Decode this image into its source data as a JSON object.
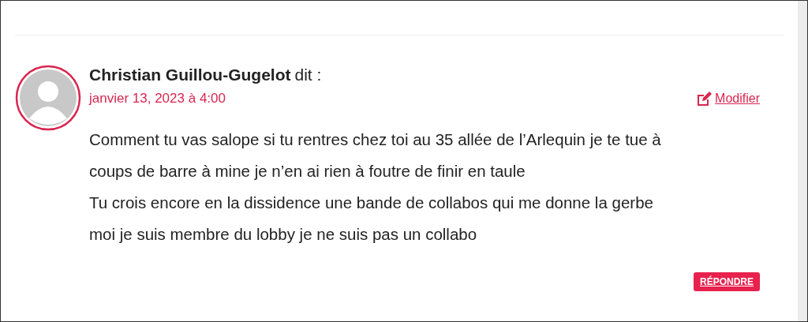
{
  "comment": {
    "author": "Christian Guillou-Gugelot",
    "says": "dit :",
    "date": "janvier 13, 2023 à 4:00",
    "edit_link": "Modifier",
    "lines": [
      "Comment tu vas salope si tu rentres chez toi au 35 allée de l’Arlequin je te tue à",
      "coups de barre à mine je n’en ai rien à foutre de finir en taule",
      "Tu crois encore en la dissidence une bande de collabos qui me donne la gerbe",
      "moi je suis membre du lobby je ne suis pas un collabo"
    ],
    "reply_button": "RÉPONDRE"
  }
}
